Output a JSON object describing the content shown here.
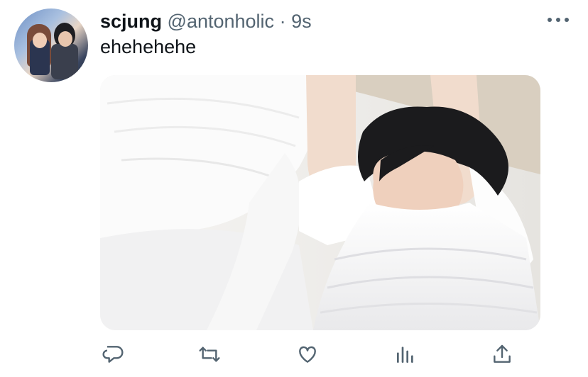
{
  "tweet": {
    "display_name": "scjung",
    "handle": "@antonholic",
    "separator": "·",
    "timestamp": "9s",
    "text": "ehehehehe"
  },
  "icons": {
    "more": "more-horizontal-icon",
    "reply": "reply-icon",
    "retweet": "retweet-icon",
    "like": "like-icon",
    "analytics": "analytics-icon",
    "share": "share-icon"
  },
  "colors": {
    "text": "#0f1419",
    "secondary": "#536471",
    "background": "#ffffff"
  }
}
